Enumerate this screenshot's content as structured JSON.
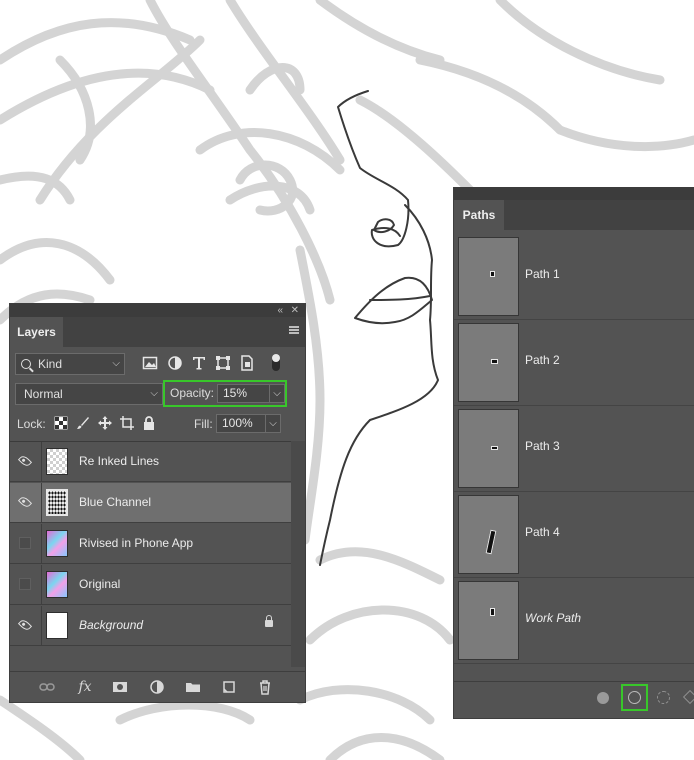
{
  "layers_panel": {
    "tab": "Layers",
    "kind_label": "Kind",
    "blend_mode": "Normal",
    "opacity_label": "Opacity:",
    "opacity_value": "15%",
    "lock_label": "Lock:",
    "fill_label": "Fill:",
    "fill_value": "100%",
    "layers": [
      {
        "name": "Re Inked Lines",
        "visible": true
      },
      {
        "name": "Blue Channel",
        "visible": true,
        "selected": true
      },
      {
        "name": "Rivised in Phone App",
        "visible": false
      },
      {
        "name": "Original",
        "visible": false
      },
      {
        "name": "Background",
        "visible": true,
        "locked": true
      }
    ],
    "bottom_icons": [
      "link-icon",
      "fx-icon",
      "mask-icon",
      "adjustment-icon",
      "folder-icon",
      "new-layer-icon",
      "trash-icon"
    ],
    "fx_label": "fx"
  },
  "paths_panel": {
    "tab": "Paths",
    "paths": [
      {
        "name": "Path 1"
      },
      {
        "name": "Path 2"
      },
      {
        "name": "Path 3"
      },
      {
        "name": "Path 4"
      },
      {
        "name": "Work Path"
      }
    ]
  },
  "colors": {
    "panel_bg": "#535353",
    "highlight_green": "#38c72a",
    "selected_row": "#6f6f6f"
  }
}
